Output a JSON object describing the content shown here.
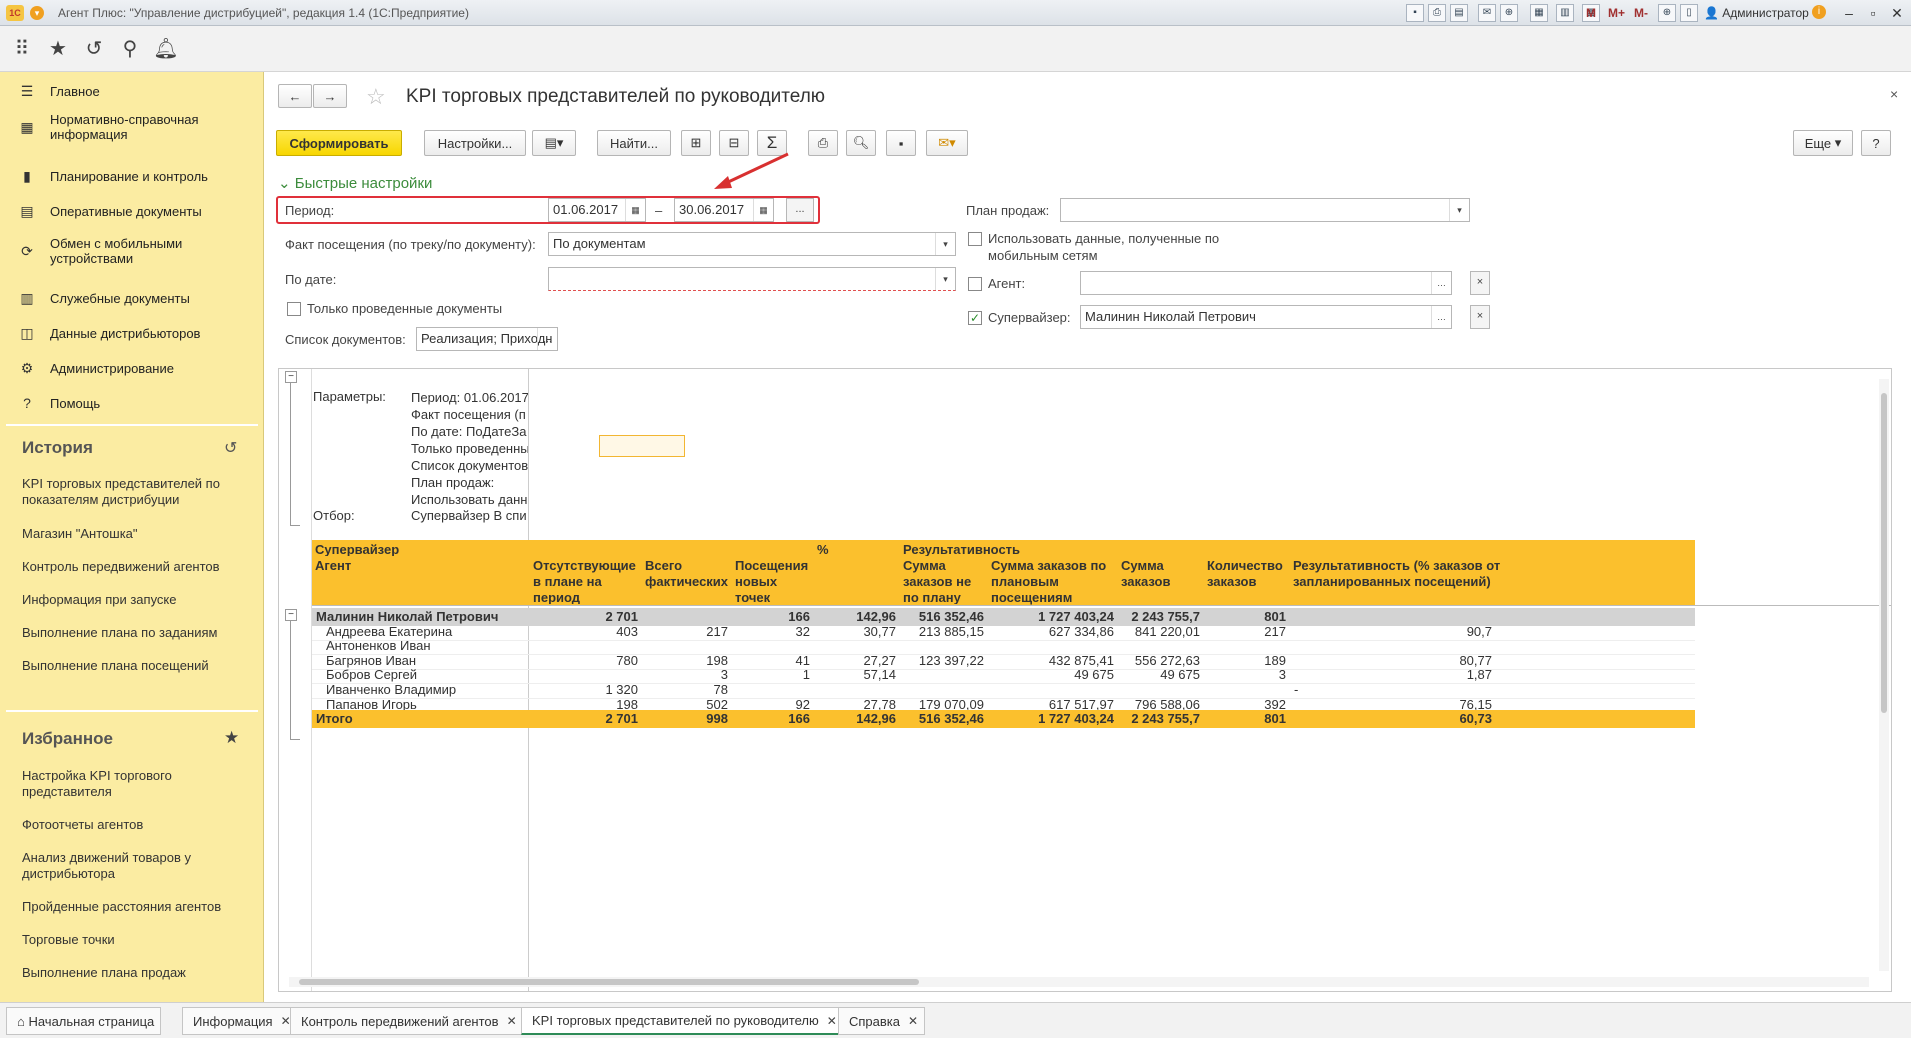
{
  "window": {
    "title": "Агент Плюс: \"Управление дистрибуцией\", редакция 1.4  (1С:Предприятие)",
    "user": "Администратор",
    "logo": "1С"
  },
  "sidebar": {
    "nav": [
      {
        "label": "Главное",
        "icon": "menu-icon"
      },
      {
        "label": "Нормативно-справочная информация",
        "icon": "table-icon"
      },
      {
        "label": "Планирование и контроль",
        "icon": "bar-chart-icon"
      },
      {
        "label": "Оперативные документы",
        "icon": "documents-icon"
      },
      {
        "label": "Обмен с мобильными устройствами",
        "icon": "sync-icon"
      },
      {
        "label": "Служебные документы",
        "icon": "service-docs-icon"
      },
      {
        "label": "Данные дистрибьюторов",
        "icon": "data-chart-icon"
      },
      {
        "label": "Администрирование",
        "icon": "gear-icon"
      },
      {
        "label": "Помощь",
        "icon": "help-icon"
      }
    ],
    "history_title": "История",
    "history": [
      "KPI торговых представителей по показателям дистрибуции",
      "Магазин \"Антошка\"",
      "Контроль передвижений агентов",
      "Информация при запуске",
      "Выполнение плана по заданиям",
      "Выполнение плана посещений"
    ],
    "favorites_title": "Избранное",
    "favorites": [
      "Настройка KPI торгового представителя",
      "Фотоотчеты агентов",
      "Анализ движений товаров у дистрибьютора",
      "Пройденные расстояния агентов",
      "Торговые точки",
      "Выполнение плана продаж"
    ]
  },
  "form": {
    "title": "KPI торговых представителей по руководителю",
    "buttons": {
      "generate": "Сформировать",
      "settings": "Настройки...",
      "find": "Найти...",
      "more": "Еще",
      "help": "?"
    },
    "quick_settings": "Быстрые настройки",
    "period_label": "Период:",
    "date_from": "01.06.2017",
    "dash": "–",
    "date_to": "30.06.2017",
    "ellipsis": "...",
    "visit_fact_label": "Факт посещения (по треку/по документу):",
    "visit_fact_value": "По документам",
    "by_date_label": "По дате:",
    "by_date_value": "",
    "only_posted_label": "Только проведенные документы",
    "doc_list_label": "Список документов:",
    "doc_list_value": "Реализация; Приходн",
    "sales_plan_label": "План продаж:",
    "sales_plan_value": "",
    "mobile_data_label": "Использовать данные, полученные по мобильным сетям",
    "agent_label": "Агент:",
    "agent_value": "",
    "supervisor_label": "Супервайзер:",
    "supervisor_value": "Малинин Николай Петрович",
    "clear": "×"
  },
  "report": {
    "params_label": "Параметры:",
    "params": [
      "Период: 01.06.2017",
      "Факт посещения (п",
      "По дате: ПоДатеЗа",
      "Только проведенны",
      "Список документов",
      "План продаж:",
      "Использовать данн"
    ],
    "filter_label": "Отбор:",
    "filter_value": "Супервайзер В спи",
    "headers": {
      "supervisor": "Супервайзер",
      "agent": "Агент",
      "absent": "Отсутствующие в плане на период",
      "total_fact": "Всего фактических",
      "new_points": "Посещения новых точек",
      "inactive": "% неактивных",
      "effectiveness": "Результативность",
      "sum_unplanned": "Сумма заказов не по плану",
      "sum_planned": "Сумма заказов по плановым посещениям",
      "sum_orders": "Сумма заказов",
      "count_orders": "Количество заказов",
      "eff_percent": "Результативность (% заказов от запланированных посещений)"
    },
    "group": {
      "name": "Малинин Николай Петрович",
      "absent": "2 701",
      "total_fact": "",
      "new_points": "166",
      "inactive": "142,96",
      "sum_unplanned": "516 352,46",
      "sum_planned": "1 727 403,24",
      "sum_orders": "2 243 755,7",
      "count_orders": "801",
      "eff_percent": ""
    },
    "rows": [
      {
        "name": "Андреева Екатерина",
        "absent": "403",
        "total_fact": "217",
        "new_points": "32",
        "inactive": "30,77",
        "sum_unplanned": "213 885,15",
        "sum_planned": "627 334,86",
        "sum_orders": "841 220,01",
        "count_orders": "217",
        "eff_percent": "90,7"
      },
      {
        "name": "Антоненков Иван",
        "absent": "",
        "total_fact": "",
        "new_points": "",
        "inactive": "",
        "sum_unplanned": "",
        "sum_planned": "",
        "sum_orders": "",
        "count_orders": "",
        "eff_percent": ""
      },
      {
        "name": "Багрянов Иван",
        "absent": "780",
        "total_fact": "198",
        "new_points": "41",
        "inactive": "27,27",
        "sum_unplanned": "123 397,22",
        "sum_planned": "432 875,41",
        "sum_orders": "556 272,63",
        "count_orders": "189",
        "eff_percent": "80,77"
      },
      {
        "name": "Бобров Сергей",
        "absent": "",
        "total_fact": "3",
        "new_points": "1",
        "inactive": "57,14",
        "sum_unplanned": "",
        "sum_planned": "49 675",
        "sum_orders": "49 675",
        "count_orders": "3",
        "eff_percent": "1,87"
      },
      {
        "name": "Иванченко Владимир",
        "absent": "1 320",
        "total_fact": "78",
        "new_points": "",
        "inactive": "",
        "sum_unplanned": "",
        "sum_planned": "",
        "sum_orders": "",
        "count_orders": "",
        "eff_percent": "-"
      },
      {
        "name": "Папанов Игорь",
        "absent": "198",
        "total_fact": "502",
        "new_points": "92",
        "inactive": "27,78",
        "sum_unplanned": "179 070,09",
        "sum_planned": "617 517,97",
        "sum_orders": "796 588,06",
        "count_orders": "392",
        "eff_percent": "76,15"
      }
    ],
    "total": {
      "name": "Итого",
      "absent": "2 701",
      "total_fact": "998",
      "new_points": "166",
      "inactive": "142,96",
      "sum_unplanned": "516 352,46",
      "sum_planned": "1 727 403,24",
      "sum_orders": "2 243 755,7",
      "count_orders": "801",
      "eff_percent": "60,73"
    }
  },
  "tabs": [
    "Начальная страница",
    "Информация",
    "Контроль передвижений агентов",
    "KPI торговых представителей по руководителю",
    "Справка"
  ]
}
